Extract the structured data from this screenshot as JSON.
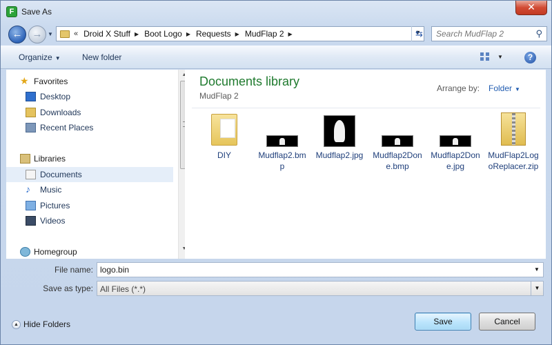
{
  "window": {
    "title": "Save As",
    "close_glyph": "✕"
  },
  "address": {
    "chevrons": "«",
    "crumbs": [
      "Droid X Stuff",
      "Boot Logo",
      "Requests",
      "MudFlap 2"
    ]
  },
  "search": {
    "placeholder": "Search MudFlap 2"
  },
  "toolbar": {
    "organize": "Organize",
    "new_folder": "New folder"
  },
  "nav": {
    "favorites": "Favorites",
    "desktop": "Desktop",
    "downloads": "Downloads",
    "recent_places": "Recent Places",
    "libraries": "Libraries",
    "documents": "Documents",
    "music": "Music",
    "pictures": "Pictures",
    "videos": "Videos",
    "homegroup": "Homegroup"
  },
  "content": {
    "title": "Documents library",
    "subtitle": "MudFlap 2",
    "arrange_label": "Arrange by:",
    "arrange_value": "Folder",
    "files": [
      {
        "name": "DIY",
        "icon": "folder-icon"
      },
      {
        "name": "Mudflap2.bmp",
        "icon": "bmp-thumbnail"
      },
      {
        "name": "Mudflap2.jpg",
        "icon": "jpg-thumbnail"
      },
      {
        "name": "Mudflap2Done.bmp",
        "icon": "bmp-thumbnail"
      },
      {
        "name": "Mudflap2Done.jpg",
        "icon": "jpg-thumbnail"
      },
      {
        "name": "MudFlap2LogoReplacer.zip",
        "icon": "zip-icon"
      }
    ]
  },
  "form": {
    "file_name_label": "File name:",
    "file_name_value": "logo.bin",
    "save_type_label": "Save as type:",
    "save_type_value": "All Files (*.*)"
  },
  "footer": {
    "hide_folders": "Hide Folders",
    "save": "Save",
    "cancel": "Cancel"
  }
}
